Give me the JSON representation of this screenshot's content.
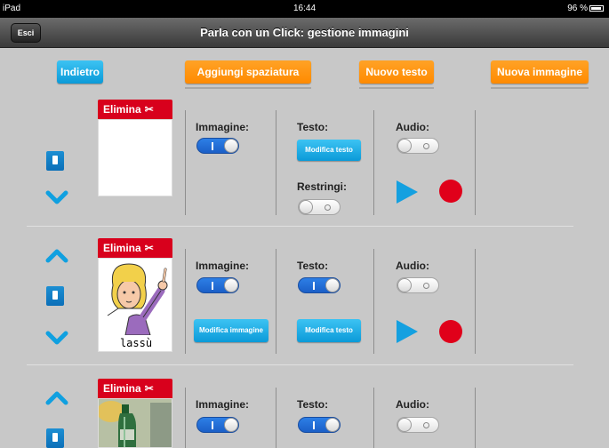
{
  "status_bar": {
    "device": "iPad",
    "time": "16:44",
    "battery": "96 %"
  },
  "nav": {
    "exit_label": "Esci",
    "title": "Parla con un Click: gestione immagini"
  },
  "toolbar": {
    "back_label": "Indietro",
    "add_spacing_label": "Aggiungi spaziatura",
    "new_text_label": "Nuovo testo",
    "new_image_label": "Nuova immagine"
  },
  "labels": {
    "delete": "Elimina",
    "image": "Immagine:",
    "text": "Testo:",
    "audio": "Audio:",
    "shrink": "Restringi:",
    "edit_text": "Modifica testo",
    "edit_image": "Modifica immagine"
  },
  "rows": [
    {
      "image": "blank",
      "image_toggle": true,
      "text_toggle": null,
      "shrink_toggle": false,
      "audio_toggle": false,
      "caption": ""
    },
    {
      "image": "girl",
      "image_toggle": true,
      "text_toggle": true,
      "shrink_toggle": null,
      "audio_toggle": false,
      "caption": "lassù"
    },
    {
      "image": "bottle",
      "image_toggle": true,
      "text_toggle": true,
      "shrink_toggle": null,
      "audio_toggle": false,
      "caption": ""
    }
  ],
  "colors": {
    "accent_blue": "#0b9ad8",
    "accent_orange": "#ff8a00",
    "delete_red": "#d8001c",
    "record_red": "#e0001a"
  }
}
